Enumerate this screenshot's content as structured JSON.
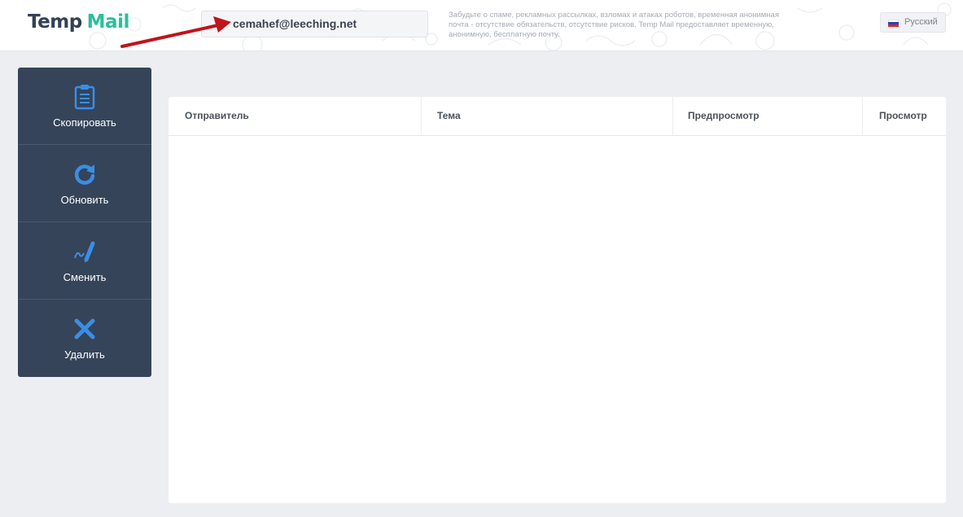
{
  "header": {
    "logo_part1": "Temp",
    "logo_part2": "Mail",
    "email": "cemahef@leeching.net",
    "tagline": "Забудьте о спаме, рекламных рассылках, взломах и атаках роботов, временная анонимная почта - отсутствие обязательств, отсутствие рисков. Temp Mail предоставляет временную, анонимную, бесплатную почту.",
    "language": "Русский"
  },
  "sidebar": {
    "items": [
      {
        "label": "Скопировать",
        "icon": "clipboard-icon"
      },
      {
        "label": "Обновить",
        "icon": "refresh-icon"
      },
      {
        "label": "Сменить",
        "icon": "pen-signature-icon"
      },
      {
        "label": "Удалить",
        "icon": "close-icon"
      }
    ]
  },
  "table": {
    "columns": [
      "Отправитель",
      "Тема",
      "Предпросмотр",
      "Просмотр"
    ]
  },
  "colors": {
    "accent_blue": "#3a8ee6",
    "sidebar_bg": "#354459",
    "logo_dark": "#334155",
    "logo_green": "#2bbf9b",
    "arrow_red": "#c0141b"
  }
}
